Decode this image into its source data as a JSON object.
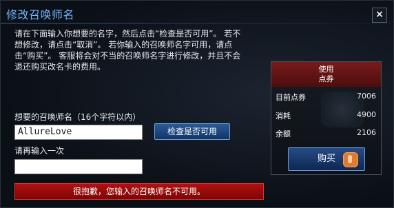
{
  "window": {
    "title": "修改召唤师名",
    "close_symbol": "×"
  },
  "instructions": {
    "line1": "请在下面输入你想要的名字，然后点击“检查是否可用”。 若不",
    "line2": "想修改，请点击“取消”。 若你输入的召唤师名字可用，请点",
    "line3": "击“购买”。 客服将会对不当的召唤师名字进行修改，并且不会",
    "line4": "退还购买改名卡的费用。"
  },
  "form": {
    "name_label": "想要的召唤师名（16个字符以内）",
    "name_value": "AllureLove",
    "check_button": "检查是否可用",
    "reenter_label": "请再输入一次",
    "reenter_value": "",
    "error_message": "很抱歉，您输入的召唤师名不可用。"
  },
  "panel": {
    "header_line1": "使用",
    "header_line2": "点券",
    "rows": [
      {
        "label": "目前点券",
        "value": "7006"
      },
      {
        "label": "消耗",
        "value": "4900"
      },
      {
        "label": "余额",
        "value": "2106"
      }
    ],
    "buy_button": "购买"
  },
  "colors": {
    "title": "#6fb6ff",
    "error_bar": "#b30f0f",
    "panel_header": "#781b1b",
    "button_blue": "#274b86"
  }
}
